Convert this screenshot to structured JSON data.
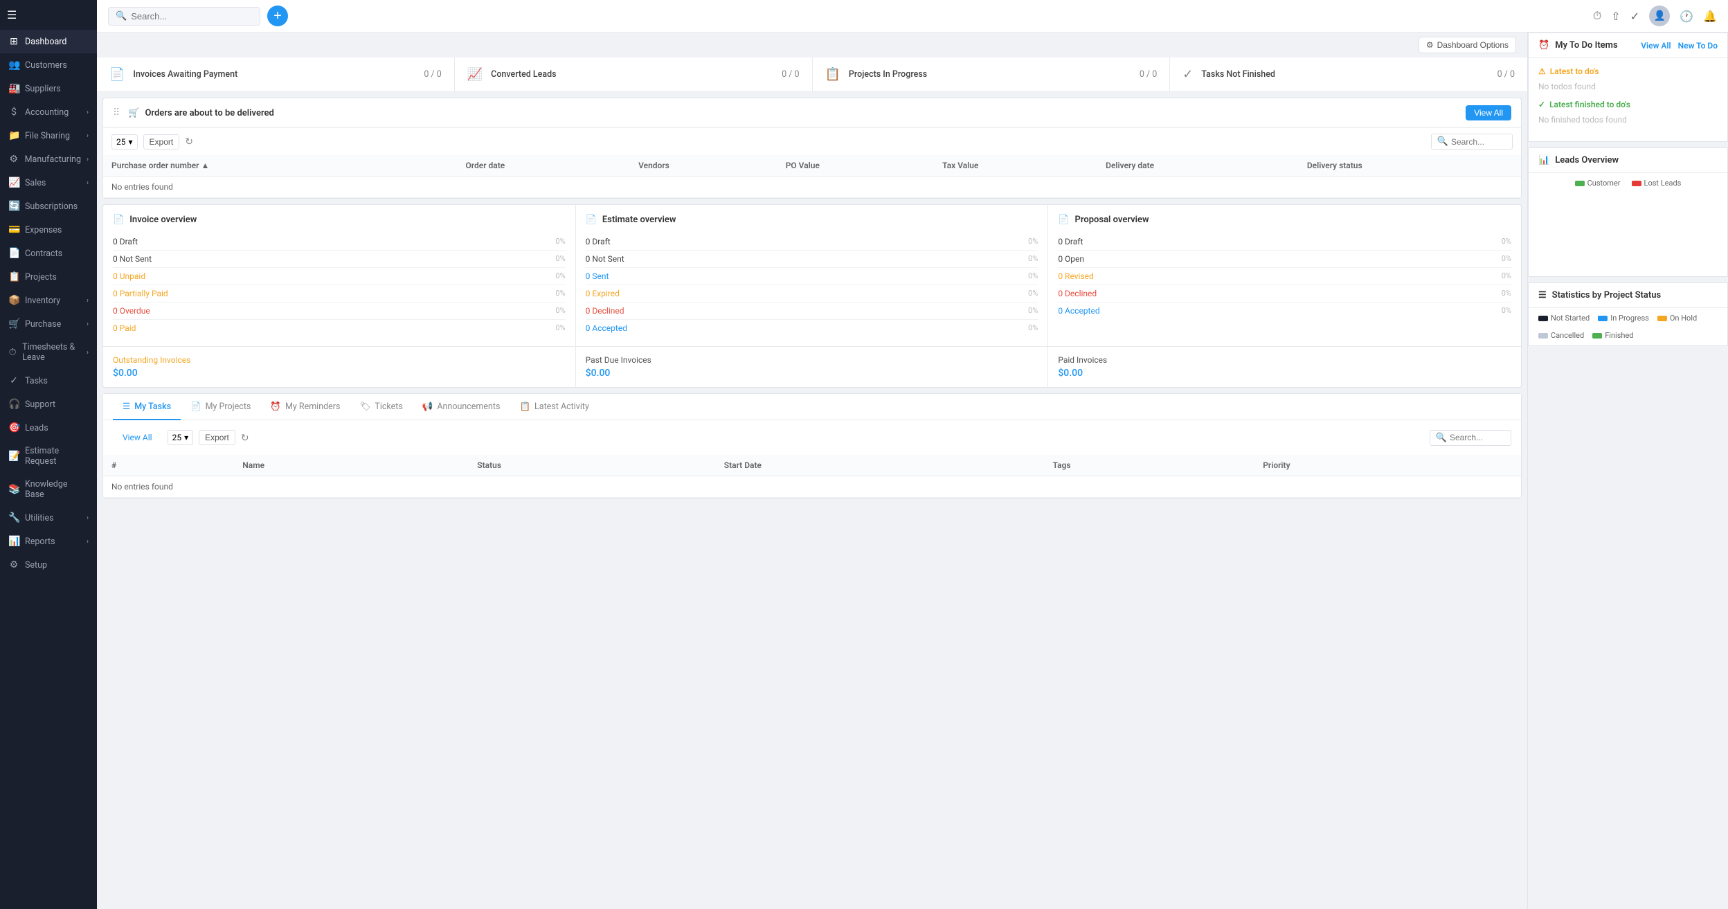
{
  "sidebar": {
    "items": [
      {
        "id": "dashboard",
        "label": "Dashboard",
        "icon": "⊞",
        "hasArrow": false
      },
      {
        "id": "customers",
        "label": "Customers",
        "icon": "👥",
        "hasArrow": false
      },
      {
        "id": "suppliers",
        "label": "Suppliers",
        "icon": "🏭",
        "hasArrow": false
      },
      {
        "id": "accounting",
        "label": "Accounting",
        "icon": "$",
        "hasArrow": true
      },
      {
        "id": "file-sharing",
        "label": "File Sharing",
        "icon": "📁",
        "hasArrow": true
      },
      {
        "id": "manufacturing",
        "label": "Manufacturing",
        "icon": "⚙",
        "hasArrow": true
      },
      {
        "id": "sales",
        "label": "Sales",
        "icon": "📈",
        "hasArrow": true
      },
      {
        "id": "subscriptions",
        "label": "Subscriptions",
        "icon": "🔄",
        "hasArrow": false
      },
      {
        "id": "expenses",
        "label": "Expenses",
        "icon": "💳",
        "hasArrow": false
      },
      {
        "id": "contracts",
        "label": "Contracts",
        "icon": "📄",
        "hasArrow": false
      },
      {
        "id": "projects",
        "label": "Projects",
        "icon": "📋",
        "hasArrow": false
      },
      {
        "id": "inventory",
        "label": "Inventory",
        "icon": "📦",
        "hasArrow": true
      },
      {
        "id": "purchase",
        "label": "Purchase",
        "icon": "🛒",
        "hasArrow": true
      },
      {
        "id": "timesheets",
        "label": "Timesheets & Leave",
        "icon": "⏱",
        "hasArrow": true
      },
      {
        "id": "tasks",
        "label": "Tasks",
        "icon": "✓",
        "hasArrow": false
      },
      {
        "id": "support",
        "label": "Support",
        "icon": "🎧",
        "hasArrow": false
      },
      {
        "id": "leads",
        "label": "Leads",
        "icon": "🎯",
        "hasArrow": false
      },
      {
        "id": "estimate-request",
        "label": "Estimate Request",
        "icon": "📝",
        "hasArrow": false
      },
      {
        "id": "knowledge-base",
        "label": "Knowledge Base",
        "icon": "📚",
        "hasArrow": false
      },
      {
        "id": "utilities",
        "label": "Utilities",
        "icon": "🔧",
        "hasArrow": true
      },
      {
        "id": "reports",
        "label": "Reports",
        "icon": "📊",
        "hasArrow": true
      },
      {
        "id": "setup",
        "label": "Setup",
        "icon": "⚙",
        "hasArrow": false
      }
    ]
  },
  "topbar": {
    "search_placeholder": "Search...",
    "add_label": "+",
    "options_label": "Dashboard Options"
  },
  "stat_cards": [
    {
      "icon": "📄",
      "label": "Invoices Awaiting Payment",
      "value": "0 / 0"
    },
    {
      "icon": "📈",
      "label": "Converted Leads",
      "value": "0 / 0"
    },
    {
      "icon": "📋",
      "label": "Projects In Progress",
      "value": "0 / 0"
    },
    {
      "icon": "✓",
      "label": "Tasks Not Finished",
      "value": "0 / 0"
    }
  ],
  "orders_section": {
    "title": "Orders are about to be delivered",
    "view_all_label": "View All",
    "table_toolbar": {
      "count": "25",
      "export_label": "Export"
    },
    "table_headers": [
      "Purchase order number",
      "Order date",
      "Vendors",
      "PO Value",
      "Tax Value",
      "Delivery date",
      "Delivery status"
    ],
    "no_entries": "No entries found"
  },
  "invoice_overview": {
    "title": "Invoice overview",
    "icon": "📄",
    "rows": [
      {
        "label": "0 Draft",
        "percent": "0%",
        "type": "normal"
      },
      {
        "label": "0 Not Sent",
        "percent": "0%",
        "type": "normal"
      },
      {
        "label": "0 Unpaid",
        "percent": "0%",
        "type": "orange"
      },
      {
        "label": "0 Partially Paid",
        "percent": "0%",
        "type": "orange"
      },
      {
        "label": "0 Overdue",
        "percent": "0%",
        "type": "red"
      },
      {
        "label": "0 Paid",
        "percent": "0%",
        "type": "orange"
      }
    ],
    "footer": {
      "outstanding_label": "Outstanding Invoices",
      "outstanding_value": "$0.00",
      "pastdue_label": "Past Due Invoices",
      "pastdue_value": "$0.00",
      "paid_label": "Paid Invoices",
      "paid_value": "$0.00"
    }
  },
  "estimate_overview": {
    "title": "Estimate overview",
    "icon": "📄",
    "rows": [
      {
        "label": "0 Draft",
        "percent": "0%",
        "type": "normal"
      },
      {
        "label": "0 Not Sent",
        "percent": "0%",
        "type": "normal"
      },
      {
        "label": "0 Sent",
        "percent": "0%",
        "type": "blue"
      },
      {
        "label": "0 Expired",
        "percent": "0%",
        "type": "orange"
      },
      {
        "label": "0 Declined",
        "percent": "0%",
        "type": "red"
      },
      {
        "label": "0 Accepted",
        "percent": "0%",
        "type": "blue"
      }
    ]
  },
  "proposal_overview": {
    "title": "Proposal overview",
    "icon": "📄",
    "rows": [
      {
        "label": "0 Draft",
        "percent": "0%",
        "type": "normal"
      },
      {
        "label": "0 Open",
        "percent": "0%",
        "type": "normal"
      },
      {
        "label": "0 Revised",
        "percent": "0%",
        "type": "orange"
      },
      {
        "label": "0 Declined",
        "percent": "0%",
        "type": "red"
      },
      {
        "label": "0 Accepted",
        "percent": "0%",
        "type": "blue"
      }
    ]
  },
  "tasks_section": {
    "tabs": [
      {
        "id": "my-tasks",
        "label": "My Tasks",
        "icon": "☰",
        "active": true
      },
      {
        "id": "my-projects",
        "label": "My Projects",
        "icon": "📄",
        "active": false
      },
      {
        "id": "my-reminders",
        "label": "My Reminders",
        "icon": "⏰",
        "active": false
      },
      {
        "id": "tickets",
        "label": "Tickets",
        "icon": "🏷",
        "active": false
      },
      {
        "id": "announcements",
        "label": "Announcements",
        "icon": "📢",
        "active": false
      },
      {
        "id": "latest-activity",
        "label": "Latest Activity",
        "icon": "📋",
        "active": false
      }
    ],
    "view_all_label": "View All",
    "table_toolbar": {
      "count": "25",
      "export_label": "Export"
    },
    "table_headers": [
      "#",
      "Name",
      "Status",
      "Start Date",
      "Tags",
      "Priority"
    ],
    "no_entries": "No entries found"
  },
  "todo_widget": {
    "title": "My To Do Items",
    "view_all_label": "View All",
    "new_todo_label": "New To Do",
    "latest_label": "Latest to do's",
    "latest_icon": "⚠",
    "no_todos": "No todos found",
    "finished_label": "Latest finished to do's",
    "finished_icon": "✓",
    "no_finished": "No finished todos found"
  },
  "leads_overview": {
    "title": "Leads Overview",
    "icon": "📊",
    "legend": [
      {
        "label": "Customer",
        "color": "#4caf50"
      },
      {
        "label": "Lost Leads",
        "color": "#e53935"
      }
    ]
  },
  "project_status": {
    "title": "Statistics by Project Status",
    "icon": "☰",
    "legend": [
      {
        "label": "Not Started",
        "color": "#1a1f2e"
      },
      {
        "label": "In Progress",
        "color": "#2196f3"
      },
      {
        "label": "On Hold",
        "color": "#f5a623"
      },
      {
        "label": "Cancelled",
        "color": "#c0c8d8"
      },
      {
        "label": "Finished",
        "color": "#4caf50"
      }
    ]
  }
}
